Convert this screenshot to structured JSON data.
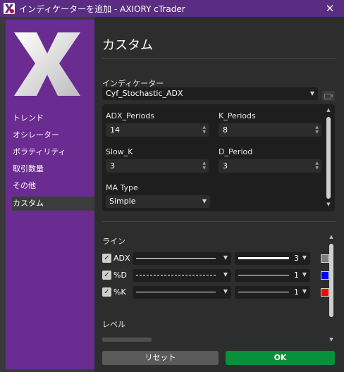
{
  "window": {
    "title": "インディケーターを追加 - AXIORY cTrader",
    "close_glyph": "✕"
  },
  "sidebar": {
    "items": [
      {
        "label": "トレンド"
      },
      {
        "label": "オシレーター"
      },
      {
        "label": "ボラティリティ"
      },
      {
        "label": "取引数量"
      },
      {
        "label": "その他"
      },
      {
        "label": "カスタム",
        "active": true
      }
    ]
  },
  "main": {
    "title": "カスタム",
    "indicator_label": "インディケーター",
    "indicator_value": "Cyf_Stochastic_ADX",
    "params": {
      "adx_periods": {
        "label": "ADX_Periods",
        "value": "14"
      },
      "k_periods": {
        "label": "K_Periods",
        "value": "8"
      },
      "slow_k": {
        "label": "Slow_K",
        "value": "3"
      },
      "d_period": {
        "label": "D_Period",
        "value": "3"
      },
      "ma_type": {
        "label": "MA Type",
        "value": "Simple"
      }
    },
    "lines_label": "ライン",
    "lines": [
      {
        "name": "ADX",
        "checked": true,
        "style": "solid",
        "width": "3",
        "color": "#7f7f7f"
      },
      {
        "name": "%D",
        "checked": true,
        "style": "dashed",
        "width": "1",
        "color": "#0000ff"
      },
      {
        "name": "%K",
        "checked": true,
        "style": "solid",
        "width": "1",
        "color": "#ff0000"
      }
    ],
    "levels_label": "レベル"
  },
  "buttons": {
    "reset": "リセット",
    "ok": "OK"
  },
  "colors": {
    "titlebar": "#5a2d82",
    "sidebar": "#6a2c91",
    "ok_button": "#07913a"
  }
}
